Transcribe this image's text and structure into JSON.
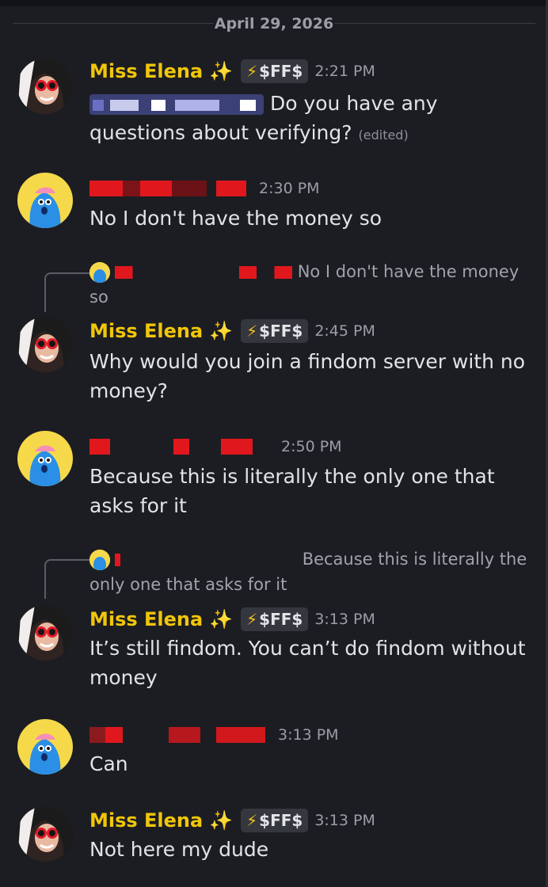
{
  "date_divider": "April 29, 2026",
  "messages": [
    {
      "author": "Miss Elena",
      "tag": "$FF$",
      "time": "2:21 PM",
      "text": "Do you have any questions about verifying?",
      "edited": "(edited)"
    },
    {
      "author": "",
      "time": "2:30 PM",
      "text": "No I don't have the money so"
    },
    {
      "reply_preview": "No I don't have the money so",
      "author": "Miss Elena",
      "tag": "$FF$",
      "time": "2:45 PM",
      "text": "Why would you join a findom server with no money?"
    },
    {
      "author": "",
      "time": "2:50 PM",
      "text": "Because this is literally the only one that asks for it"
    },
    {
      "reply_preview": "Because this is literally the only one that asks for it",
      "author": "Miss Elena",
      "tag": "$FF$",
      "time": "3:13 PM",
      "text": "It’s still findom. You can’t do findom without money"
    },
    {
      "author": "",
      "time": "3:13 PM",
      "text": "Can"
    },
    {
      "author": "Miss Elena",
      "tag": "$FF$",
      "time": "3:13 PM",
      "text": "Not here my dude"
    }
  ],
  "colors": {
    "background": "#1c1d22",
    "name": "#f0c60a",
    "redaction": "#e0181d",
    "mention": "#3b4075"
  },
  "icons": {
    "sparkle": "sparkles-icon",
    "bolt": "lightning-icon",
    "elena_avatar": "user-photo-avatar",
    "user_avatar": "blue-creature-avatar"
  }
}
